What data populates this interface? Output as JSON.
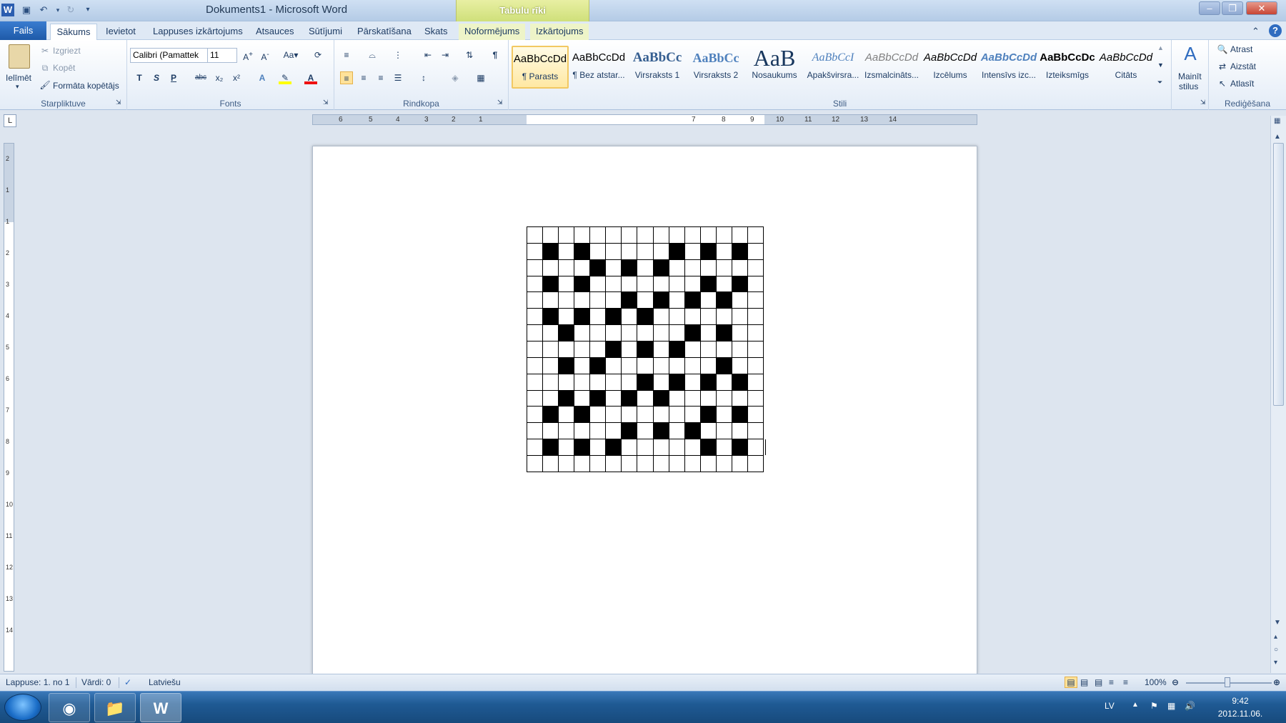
{
  "window": {
    "doc_title": "Dokuments1 - Microsoft Word",
    "context_tab_group": "Tabulu rīki"
  },
  "tabs": [
    "Fails",
    "Sākums",
    "Ievietot",
    "Lappuses izkārtojums",
    "Atsauces",
    "Sūtījumi",
    "Pārskatīšana",
    "Skats",
    "Noformējums",
    "Izkārtojums"
  ],
  "ribbon": {
    "clipboard": {
      "paste_label": "Ielīmēt",
      "cut_label": "Izgriezt",
      "copy_label": "Kopēt",
      "format_painter_label": "Formāta kopētājs",
      "group_label": "Starpliktuve"
    },
    "font": {
      "font_name": "Calibri (Pamattek",
      "font_size": "11",
      "group_label": "Fonts",
      "bold": "T",
      "italic": "S",
      "underline": "P"
    },
    "paragraph": {
      "group_label": "Rindkopa"
    },
    "styles": {
      "group_label": "Stili",
      "items": [
        {
          "sample": "AaBbCcDd",
          "name": "¶ Parasts"
        },
        {
          "sample": "AaBbCcDd",
          "name": "¶ Bez atstar..."
        },
        {
          "sample": "AaBbCc",
          "name": "Virsraksts 1"
        },
        {
          "sample": "AaBbCc",
          "name": "Virsraksts 2"
        },
        {
          "sample": "AaB",
          "name": "Nosaukums"
        },
        {
          "sample": "AaBbCcI",
          "name": "Apakšvirsra..."
        },
        {
          "sample": "AaBbCcDd",
          "name": "Izsmalcināts..."
        },
        {
          "sample": "AaBbCcDd",
          "name": "Izcēlums"
        },
        {
          "sample": "AaBbCcDd",
          "name": "Intensīvs izc..."
        },
        {
          "sample": "AaBbCcDc",
          "name": "Izteiksmīgs"
        },
        {
          "sample": "AaBbCcDd",
          "name": "Citāts"
        }
      ],
      "change_styles_label_1": "Mainīt",
      "change_styles_label_2": "stilus"
    },
    "editing": {
      "find_label": "Atrast",
      "replace_label": "Aizstāt",
      "select_label": "Atlasīt",
      "group_label": "Rediģēšana"
    }
  },
  "ruler": {
    "h_numbers": [
      "6",
      "5",
      "4",
      "3",
      "2",
      "1",
      "7",
      "8",
      "9",
      "10",
      "11",
      "12",
      "13",
      "14"
    ],
    "v_numbers": [
      "2",
      "1",
      "1",
      "2",
      "3",
      "4",
      "5",
      "6",
      "7",
      "8",
      "9",
      "10",
      "11",
      "12",
      "13",
      "14"
    ]
  },
  "table_grid": {
    "rows": 15,
    "cols": 15,
    "black_cells": [
      [
        1,
        1
      ],
      [
        1,
        3
      ],
      [
        1,
        9
      ],
      [
        1,
        11
      ],
      [
        1,
        13
      ],
      [
        2,
        4
      ],
      [
        2,
        6
      ],
      [
        2,
        8
      ],
      [
        3,
        1
      ],
      [
        3,
        3
      ],
      [
        3,
        11
      ],
      [
        3,
        13
      ],
      [
        4,
        6
      ],
      [
        4,
        8
      ],
      [
        4,
        10
      ],
      [
        4,
        12
      ],
      [
        5,
        1
      ],
      [
        5,
        3
      ],
      [
        5,
        5
      ],
      [
        5,
        7
      ],
      [
        6,
        2
      ],
      [
        6,
        10
      ],
      [
        6,
        12
      ],
      [
        7,
        5
      ],
      [
        7,
        7
      ],
      [
        7,
        9
      ],
      [
        8,
        2
      ],
      [
        8,
        4
      ],
      [
        8,
        12
      ],
      [
        9,
        7
      ],
      [
        9,
        9
      ],
      [
        9,
        11
      ],
      [
        9,
        13
      ],
      [
        10,
        2
      ],
      [
        10,
        4
      ],
      [
        10,
        6
      ],
      [
        10,
        8
      ],
      [
        11,
        1
      ],
      [
        11,
        3
      ],
      [
        11,
        11
      ],
      [
        11,
        13
      ],
      [
        12,
        6
      ],
      [
        12,
        8
      ],
      [
        12,
        10
      ],
      [
        13,
        1
      ],
      [
        13,
        3
      ],
      [
        13,
        5
      ],
      [
        13,
        11
      ],
      [
        13,
        13
      ]
    ]
  },
  "status": {
    "page": "Lappuse: 1. no 1",
    "words": "Vārdi: 0",
    "language": "Latviešu",
    "zoom": "100%"
  },
  "taskbar": {
    "language": "LV",
    "time": "9:42",
    "date": "2012.11.06."
  }
}
